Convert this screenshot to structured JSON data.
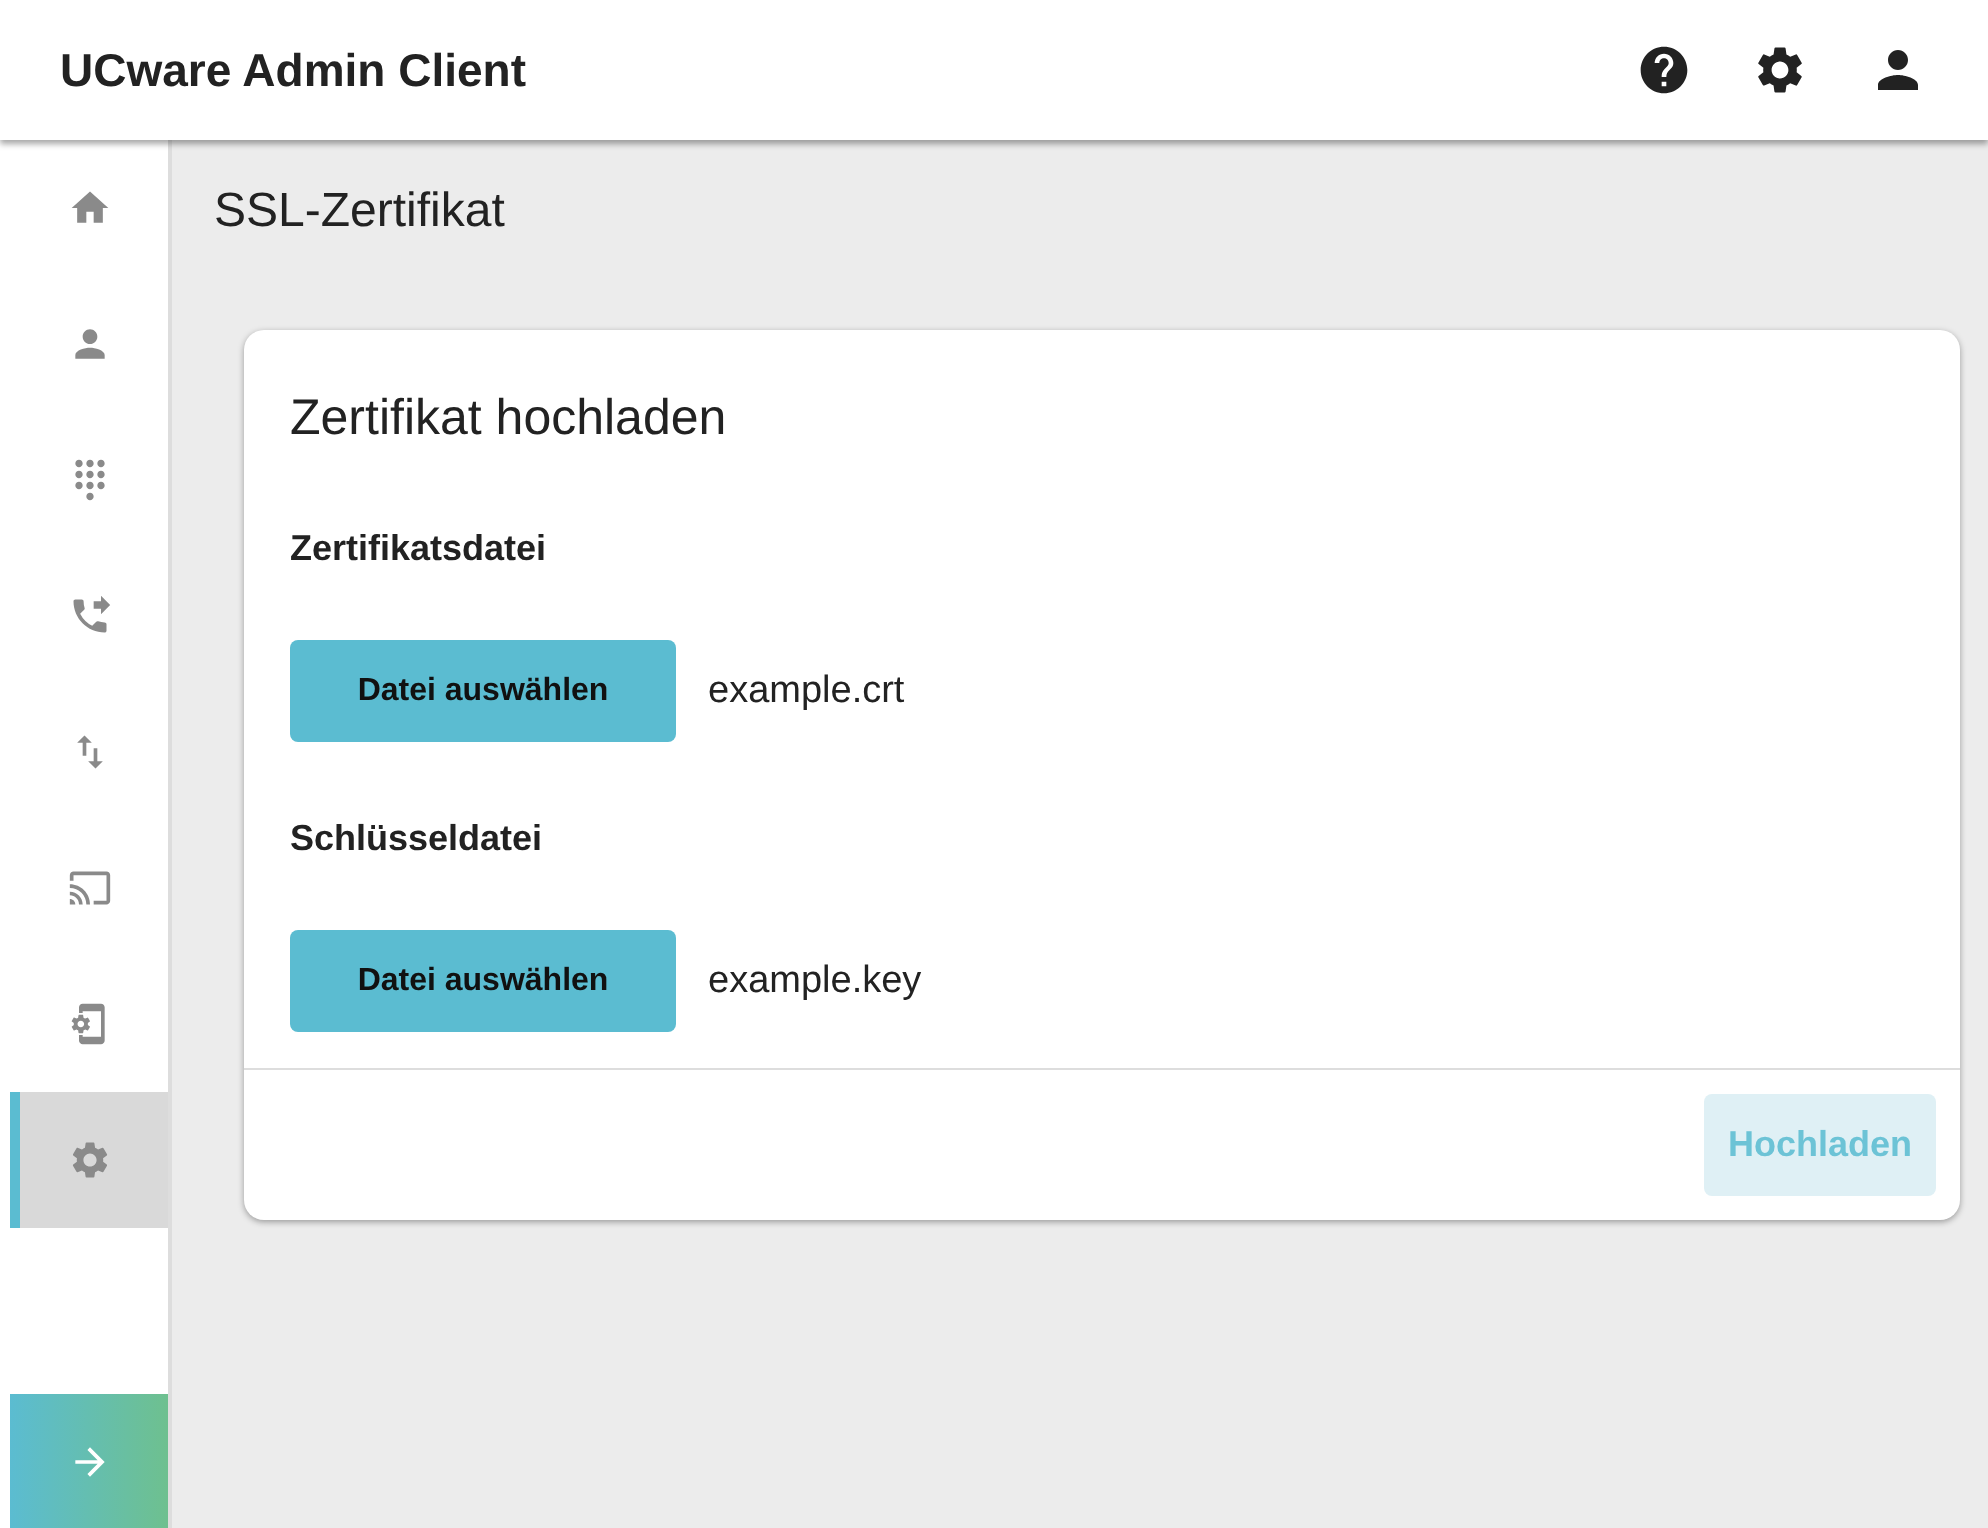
{
  "header": {
    "title": "UCware Admin Client"
  },
  "sidebar": {
    "items": [
      {
        "kind": "home",
        "selected": false
      },
      {
        "kind": "user",
        "selected": false
      },
      {
        "kind": "dialpad",
        "selected": false
      },
      {
        "kind": "forward",
        "selected": false
      },
      {
        "kind": "transfer",
        "selected": false
      },
      {
        "kind": "cast",
        "selected": false
      },
      {
        "kind": "device",
        "selected": false
      },
      {
        "kind": "settings",
        "selected": true
      }
    ]
  },
  "page": {
    "title": "SSL-Zertifikat"
  },
  "card": {
    "title": "Zertifikat hochladen",
    "files": [
      {
        "label": "Zertifikatsdatei",
        "button": "Datei auswählen",
        "filename": "example.crt"
      },
      {
        "label": "Schlüsseldatei",
        "button": "Datei auswählen",
        "filename": "example.key"
      }
    ],
    "submit": {
      "label": "Hochladen",
      "disabled": true
    }
  }
}
